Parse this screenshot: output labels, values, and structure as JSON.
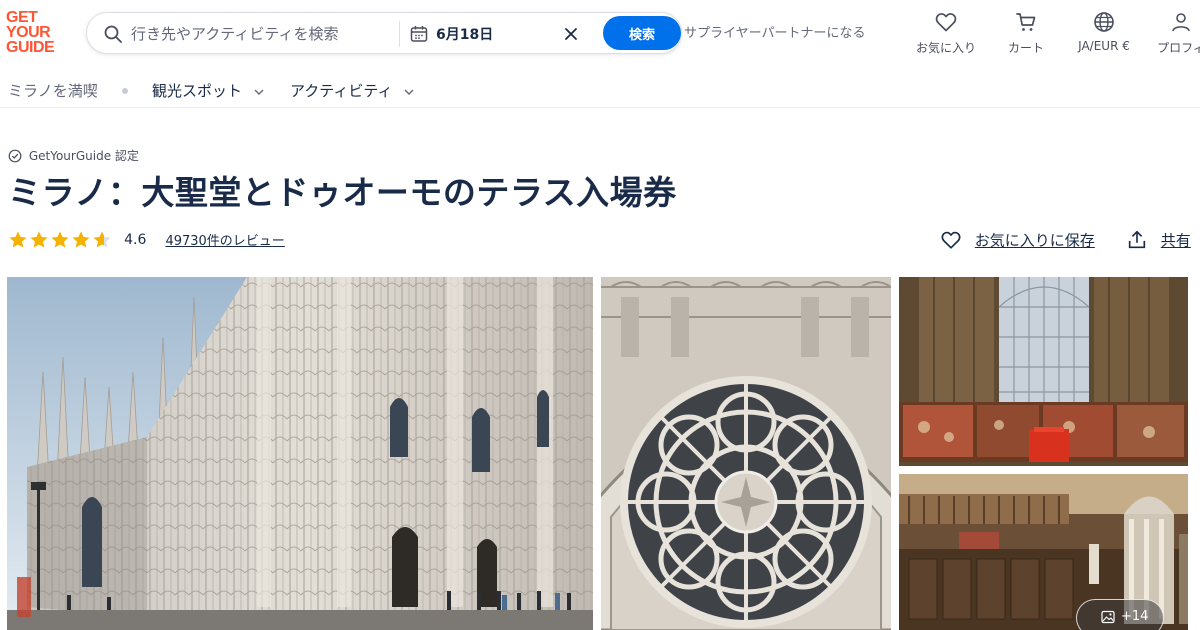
{
  "brand": {
    "logo_lines": [
      "GET",
      "YOUR",
      "GUIDE"
    ],
    "accent": "#ff5533"
  },
  "search": {
    "placeholder": "行き先やアクティビティを検索",
    "date": "6月18日",
    "button_label": "検索",
    "button_color": "#0071eb"
  },
  "header": {
    "supplier_link": "サプライヤーパートナーになる",
    "nav": {
      "favorites": "お気に入り",
      "cart": "カート",
      "language": "JA/EUR €",
      "profile": "プロフィ"
    }
  },
  "subnav": {
    "breadcrumb": "ミラノを満喫",
    "menus": [
      "観光スポット",
      "アクティビティ"
    ]
  },
  "product": {
    "badge": "GetYourGuide 認定",
    "title": "ミラノ：大聖堂とドゥオーモのテラス入場券",
    "rating": 4.6,
    "rating_text": "4.6",
    "review_link": "49730件のレビュー",
    "star_color": "#f5b301",
    "save_label": "お気に入りに保存",
    "share_label": "共有"
  },
  "gallery": {
    "photos": [
      {
        "name": "duomo-facade-photo"
      },
      {
        "name": "rose-window-photo"
      },
      {
        "name": "stained-glass-interior-photo"
      },
      {
        "name": "choir-interior-photo"
      }
    ],
    "more_count": "+14"
  }
}
